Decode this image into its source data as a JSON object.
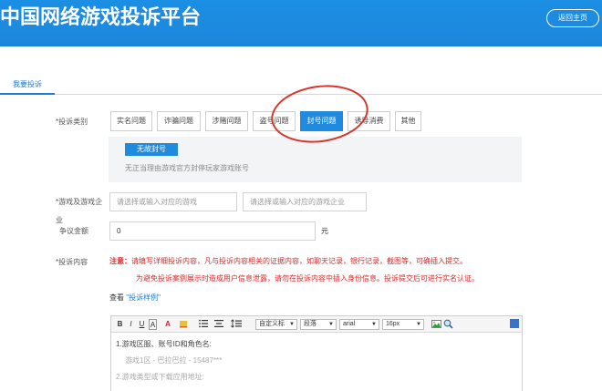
{
  "header": {
    "site_title": "中国网络游戏投诉平台",
    "home_button": "返回主页",
    "bg_color": "#1b8fe4"
  },
  "tabs": {
    "active": "我要投诉"
  },
  "form": {
    "type_label": "*投诉类别",
    "types": [
      {
        "label": "实名问题",
        "active": false
      },
      {
        "label": "诈骗问题",
        "active": false
      },
      {
        "label": "涉赌问题",
        "active": false
      },
      {
        "label": "盗号问题",
        "active": false
      },
      {
        "label": "封号问题",
        "active": true
      },
      {
        "label": "诱导消费",
        "active": false
      },
      {
        "label": "其他",
        "active": false
      }
    ],
    "sub_tag": "无故封号",
    "sub_desc": "无正当理由游戏官方封停玩家游戏账号",
    "game_label": "*游戏及游戏企",
    "game_label_wrap": "业",
    "game_placeholder": "请选择或输入对应的游戏",
    "company_placeholder": "请选择或输入对应的游戏企业",
    "amount_label": "争议金额",
    "amount_value": "0",
    "amount_unit": "元",
    "content_label": "*投诉内容",
    "notice_prefix": "注意：",
    "notice_line1": "请填写详细投诉内容，凡与投诉内容相关的证据内容，如聊天记录，银行记录，截图等，可确插入提交。",
    "notice_line2": "为避免投诉案例展示时造成用户信息泄露，请勿在投诉内容中插入身份信息。投诉提交后可进行实名认证。",
    "sample_prefix": "查看",
    "sample_link": "\"投诉样例\"",
    "accent_color": "#1f8ade",
    "warning_color": "#d72a2a"
  },
  "editor": {
    "toolbar": {
      "bold": "B",
      "italic": "I",
      "underline": "U",
      "strike": "A",
      "font_color": "A",
      "custom_style": "自定义标",
      "paragraph": "段落",
      "font": "arial",
      "size": "16px"
    },
    "lines": [
      {
        "text": "1.游戏区服、账号ID和角色名:",
        "kind": "q"
      },
      {
        "text": "游戏1区 - 巴拉巴拉 - 15487***",
        "kind": "a"
      },
      {
        "text": "2.游戏类型或下载应用地址:",
        "kind": "q"
      }
    ]
  }
}
